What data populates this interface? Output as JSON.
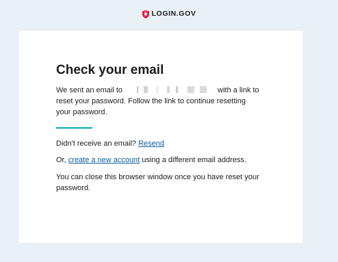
{
  "header": {
    "brand_text": "LOGIN.GOV",
    "brand_color": "#e21c3d",
    "logo_icon": "shield-icon"
  },
  "main": {
    "title": "Check your email",
    "message_prefix": "We sent an email to",
    "message_suffix": "with a link to reset your password. Follow the link to continue resetting your password.",
    "divider_color": "#00a7b5",
    "resend_prompt": "Didn't receive an email?",
    "resend_link": "Resend",
    "or_prefix": "Or,",
    "create_account_link": "create a new account",
    "or_suffix": "using a different email address.",
    "close_message": "You can close this browser window once you have reset your password."
  }
}
